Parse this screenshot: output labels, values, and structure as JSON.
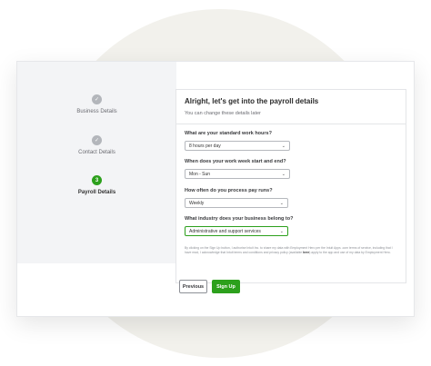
{
  "steps": [
    {
      "label": "Business Details",
      "status": "done",
      "icon": "check-icon"
    },
    {
      "label": "Contact Details",
      "status": "done",
      "icon": "check-icon"
    },
    {
      "label": "Payroll Details",
      "status": "current",
      "number": "3"
    }
  ],
  "form": {
    "title": "Alright, let's get into the payroll details",
    "subtitle": "You can change these details later",
    "questions": [
      {
        "label": "What are your standard work hours?",
        "value": "8 hours per day"
      },
      {
        "label": "When does your work week start and end?",
        "value": "Mon - Sun"
      },
      {
        "label": "How often do you process pay runs?",
        "value": "Weekly"
      },
      {
        "label": "What industry does your business belong to?",
        "value": "Administrative and support services"
      }
    ],
    "consent_pre": "By clicking on the Sign Up button, I authorise Intuit Inc. to share my data with Employment Hero per the Intuit Apps .com terms of service, including that I have read, I acknowledge that Intuit terms and conditions and privacy policy (available ",
    "consent_link": "here",
    "consent_post": ") apply to the app and use of my data by Employment Hero."
  },
  "buttons": {
    "previous": "Previous",
    "signup": "Sign Up"
  },
  "colors": {
    "accent": "#2ca01c",
    "background_circle": "#f2f1ec",
    "steps_panel": "#f3f4f6"
  }
}
